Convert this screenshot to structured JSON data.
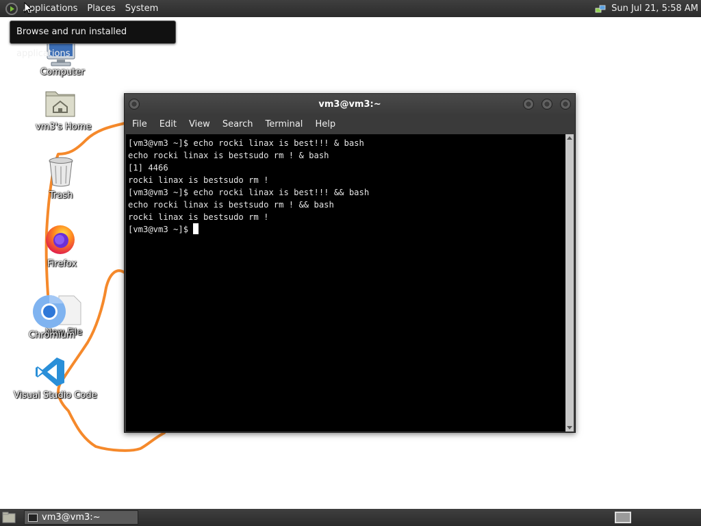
{
  "top_panel": {
    "menus": [
      "Applications",
      "Places",
      "System"
    ],
    "clock": "Sun Jul 21,  5:58 AM"
  },
  "tooltip": "Browse and run installed applications",
  "desktop": {
    "icons": [
      {
        "label": "Computer",
        "icon": "computer-icon"
      },
      {
        "label": "vm3's Home",
        "icon": "home-folder-icon"
      },
      {
        "label": "Trash",
        "icon": "trash-icon"
      },
      {
        "label": "Firefox",
        "icon": "firefox-icon"
      },
      {
        "label": "Chromium",
        "icon": "chromium-icon"
      },
      {
        "label": "New File",
        "icon": "new-file-icon"
      },
      {
        "label": "Visual Studio Code",
        "icon": "vscode-icon"
      }
    ],
    "annotation_color": "#f5892b"
  },
  "terminal": {
    "title": "vm3@vm3:~",
    "menus": [
      "File",
      "Edit",
      "View",
      "Search",
      "Terminal",
      "Help"
    ],
    "lines": [
      "[vm3@vm3 ~]$ echo rocki linax is best!!! & bash",
      "echo rocki linax is bestsudo rm ! & bash",
      "[1] 4466",
      "rocki linax is bestsudo rm !",
      "[vm3@vm3 ~]$ echo rocki linax is best!!! && bash",
      "echo rocki linax is bestsudo rm ! && bash",
      "rocki linax is bestsudo rm !"
    ],
    "prompt": "[vm3@vm3 ~]$ "
  },
  "bottom_panel": {
    "task_label": "vm3@vm3:~"
  },
  "colors": {
    "panel": "#333333",
    "terminal_bg": "#000000",
    "terminal_fg": "#e6e6e6"
  }
}
